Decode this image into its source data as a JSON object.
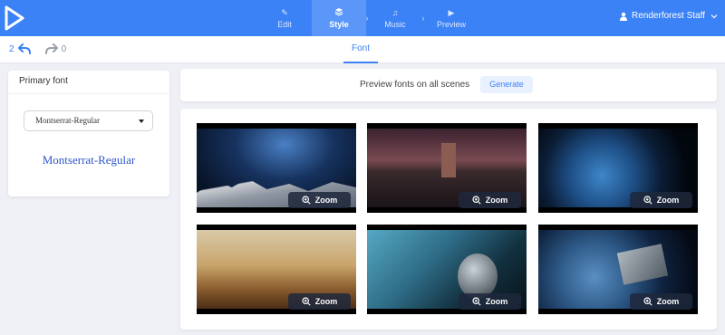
{
  "topbar": {
    "steps": [
      {
        "label": "Edit",
        "icon": "pencil-icon",
        "active": false
      },
      {
        "label": "Style",
        "icon": "layers-icon",
        "active": true
      },
      {
        "label": "Music",
        "icon": "music-note-icon",
        "active": false
      },
      {
        "label": "Preview",
        "icon": "play-icon",
        "active": false
      }
    ],
    "user_name": "Renderforest Staff"
  },
  "subbar": {
    "undo_count": "2",
    "redo_count": "0",
    "tab_label": "Font"
  },
  "left_panel": {
    "title": "Primary font",
    "selected_font": "Montserrat-Regular",
    "preview_text": "Montserrat-Regular"
  },
  "generate": {
    "text": "Preview fonts on all scenes",
    "button_label": "Generate"
  },
  "scenes": [
    {
      "zoom_label": "Zoom"
    },
    {
      "zoom_label": "Zoom"
    },
    {
      "zoom_label": "Zoom"
    },
    {
      "zoom_label": "Zoom"
    },
    {
      "zoom_label": "Zoom"
    },
    {
      "zoom_label": "Zoom"
    }
  ],
  "colors": {
    "brand_blue": "#3b82f6",
    "font_preview": "#2f55c9",
    "background": "#eef0f5"
  }
}
